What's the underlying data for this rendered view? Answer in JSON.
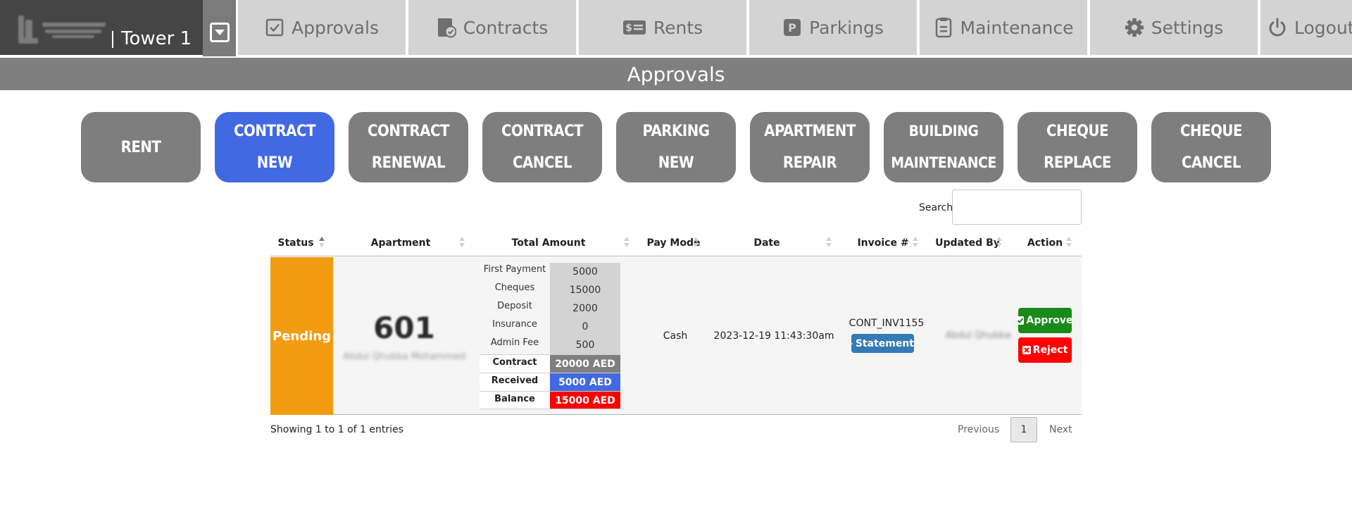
{
  "brand": {
    "title": "Tower 1"
  },
  "nav": [
    {
      "label": "Approvals",
      "icon": "check-square-icon"
    },
    {
      "label": "Contracts",
      "icon": "contract-file-icon"
    },
    {
      "label": "Rents",
      "icon": "money-bill-icon"
    },
    {
      "label": "Parkings",
      "icon": "parking-icon"
    },
    {
      "label": "Maintenance",
      "icon": "clipboard-icon"
    },
    {
      "label": "Settings",
      "icon": "gear-icon"
    },
    {
      "label": "Logout",
      "icon": "power-icon"
    }
  ],
  "page_title": "Approvals",
  "categories": [
    {
      "line1": "RENT",
      "line2": "",
      "active": false
    },
    {
      "line1": "CONTRACT",
      "line2": "NEW",
      "active": true
    },
    {
      "line1": "CONTRACT",
      "line2": "RENEWAL",
      "active": false
    },
    {
      "line1": "CONTRACT",
      "line2": "CANCEL",
      "active": false
    },
    {
      "line1": "PARKING",
      "line2": "NEW",
      "active": false
    },
    {
      "line1": "APARTMENT",
      "line2": "REPAIR",
      "active": false
    },
    {
      "line1": "BUILDING",
      "line2": "MAINTENANCE",
      "active": false
    },
    {
      "line1": "CHEQUE",
      "line2": "REPLACE",
      "active": false
    },
    {
      "line1": "CHEQUE",
      "line2": "CANCEL",
      "active": false
    }
  ],
  "search": {
    "label": "Search:",
    "value": ""
  },
  "table": {
    "columns": [
      "Status",
      "Apartment",
      "Total Amount",
      "Pay Mode",
      "Date",
      "Invoice #",
      "Updated By",
      "Action"
    ],
    "rows": [
      {
        "status": "Pending",
        "status_color": "#f39c12",
        "apartment": "601",
        "apartment_owner": "Abdul Qhubba Mohammed",
        "amounts": [
          {
            "label": "First Payment",
            "value": "5000"
          },
          {
            "label": "Cheques",
            "value": "15000"
          },
          {
            "label": "Deposit",
            "value": "2000"
          },
          {
            "label": "Insurance",
            "value": "0"
          },
          {
            "label": "Admin Fee",
            "value": "500"
          }
        ],
        "totals": [
          {
            "label": "Contract",
            "value": "20000 AED",
            "color": "#7f7f7f"
          },
          {
            "label": "Received",
            "value": "5000 AED",
            "color": "#4169e1"
          },
          {
            "label": "Balance",
            "value": "15000 AED",
            "color": "#ff0000"
          }
        ],
        "pay_mode": "Cash",
        "date": "2023-12-19 11:43:30am",
        "invoice": "CONT_INV1155",
        "statement_label": "Statement",
        "updated_by": "Abdul Qhubba",
        "approve_label": "Approve",
        "reject_label": "Reject"
      }
    ]
  },
  "footer": {
    "showing": "Showing 1 to 1 of 1 entries",
    "previous": "Previous",
    "current_page": "1",
    "next": "Next"
  }
}
